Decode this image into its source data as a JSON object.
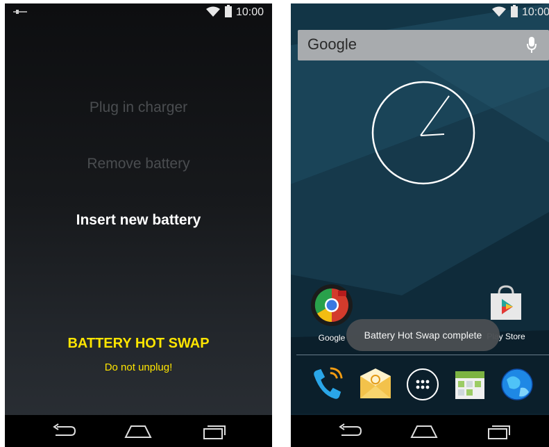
{
  "left_screen": {
    "status": {
      "time": "10:00",
      "icons": [
        "usb-icon",
        "wifi-icon",
        "battery-icon"
      ]
    },
    "steps": [
      {
        "label": "Plug in charger",
        "state": "done"
      },
      {
        "label": "Remove battery",
        "state": "done"
      },
      {
        "label": "Insert new battery",
        "state": "current"
      }
    ],
    "hot_swap": {
      "title": "BATTERY HOT SWAP",
      "subtitle": "Do not unplug!"
    },
    "navbar": [
      "back-icon",
      "home-icon",
      "recents-icon"
    ]
  },
  "right_screen": {
    "status": {
      "time": "10:00",
      "icons": [
        "wifi-icon",
        "battery-icon"
      ]
    },
    "search": {
      "label": "Google"
    },
    "apps": [
      {
        "label": "Google",
        "icon": "chrome-icon"
      },
      {
        "label": "Play Store",
        "icon": "play-store-icon"
      }
    ],
    "toast": "Battery Hot Swap complete",
    "dock": [
      "phone-icon",
      "email-icon",
      "app-drawer-icon",
      "calendar-icon",
      "browser-icon"
    ],
    "navbar": [
      "back-icon",
      "home-icon",
      "recents-icon"
    ]
  },
  "colors": {
    "accent_yellow": "#ffe500",
    "toast_bg": "#4a4e52",
    "search_bg": "#a8abae"
  }
}
